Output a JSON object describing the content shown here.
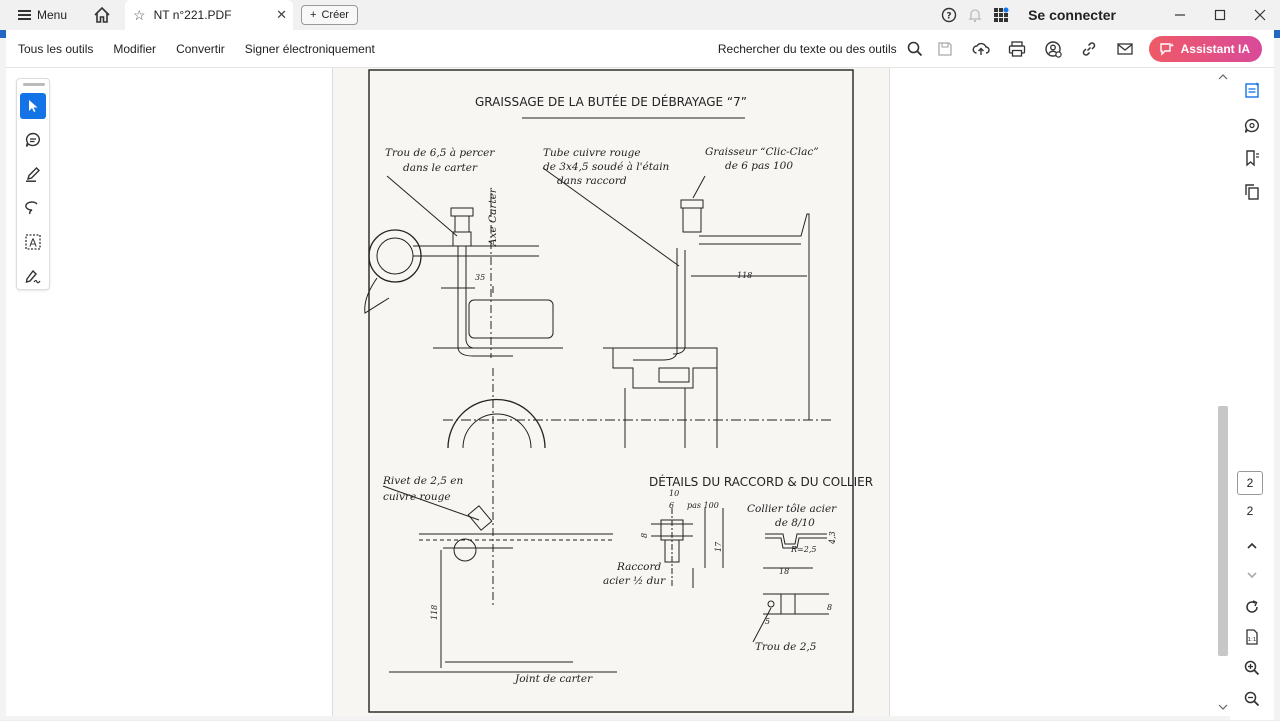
{
  "titlebar": {
    "menu_label": "Menu",
    "tab_title": "NT n°221.PDF",
    "create_label": "Créer",
    "signin_label": "Se connecter"
  },
  "toolbar": {
    "items": [
      "Tous les outils",
      "Modifier",
      "Convertir",
      "Signer électroniquement"
    ],
    "search_label": "Rechercher du texte ou des outils",
    "ai_label": "Assistant IA"
  },
  "page_nav": {
    "current": "2",
    "total": "2"
  },
  "drawing": {
    "title": "GRAISSAGE DE LA BUTÉE DE DÉBRAYAGE “7”",
    "note_hole": [
      "Trou de 6,5 à percer",
      "dans le carter"
    ],
    "axis_label": "Axe Carter",
    "note_tube": [
      "Tube cuivre rouge",
      "de 3x4,5 soudé à l'étain",
      "dans raccord"
    ],
    "note_greaser": [
      "Graisseur “Clic-Clac”",
      "de 6 pas 100"
    ],
    "dim_35": "35",
    "dim_118_top": "118",
    "details_title": "DÉTAILS DU RACCORD & DU COLLIER",
    "note_rivet": [
      "Rivet de 2,5 en",
      "cuivre rouge"
    ],
    "dim_118_side": "118",
    "note_raccord": [
      "Raccord",
      "acier ½ dur"
    ],
    "note_collier": [
      "Collier tôle acier",
      "de 8/10"
    ],
    "dim_10": "10",
    "dim_6": "6",
    "dim_pas100": "pas 100",
    "dim_8": "8",
    "dim_17": "17",
    "dim_r25": "R=2,5",
    "dim_18": "18",
    "dim_43": "4,3",
    "dim_8b": "8",
    "dim_5": "5",
    "note_trou": "Trou de 2,5",
    "note_joint": "Joint de carter"
  }
}
